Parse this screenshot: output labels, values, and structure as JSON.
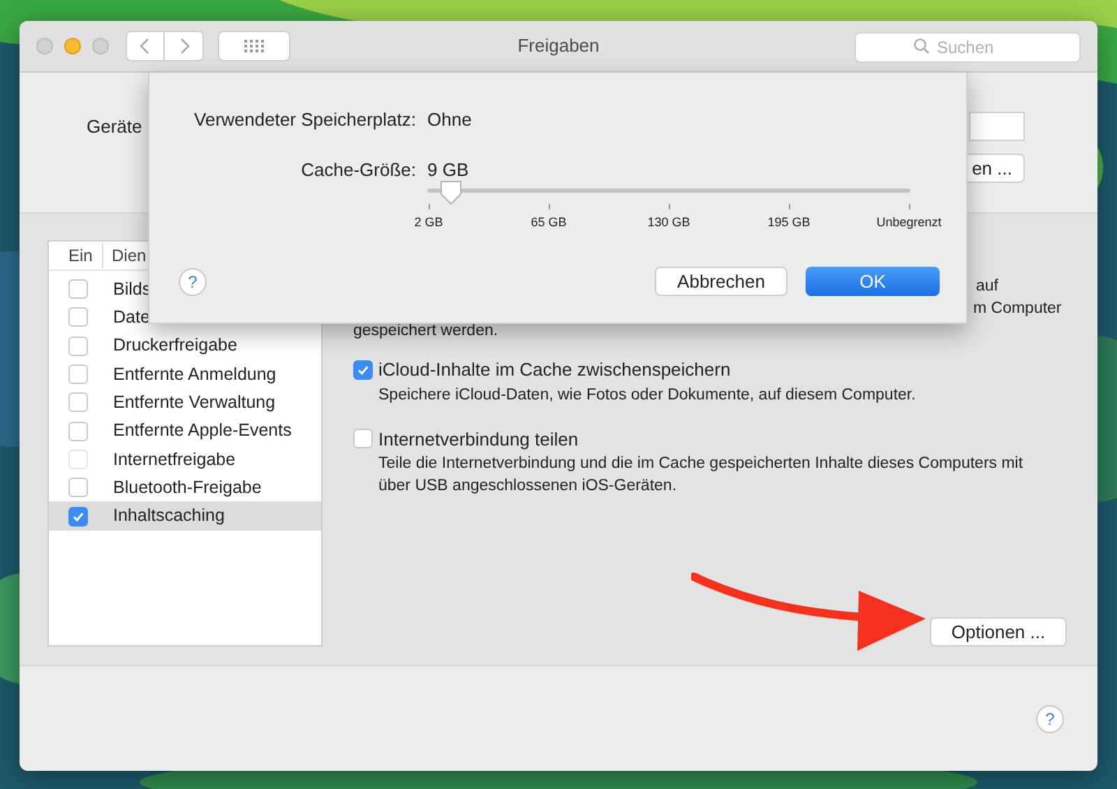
{
  "window": {
    "title": "Freigaben"
  },
  "toolbar": {
    "search": {
      "placeholder": "Suchen"
    }
  },
  "header": {
    "name_label": "Geräte",
    "edit_button": "en ..."
  },
  "services": {
    "columns": [
      "Ein",
      "Dien"
    ],
    "items": [
      {
        "label": "Bilds",
        "checked": false,
        "selected": false,
        "disabled": false
      },
      {
        "label": "Date",
        "checked": false,
        "selected": false,
        "disabled": false
      },
      {
        "label": "Druckerfreigabe",
        "checked": false,
        "selected": false,
        "disabled": false
      },
      {
        "label": "Entfernte Anmeldung",
        "checked": false,
        "selected": false,
        "disabled": false
      },
      {
        "label": "Entfernte Verwaltung",
        "checked": false,
        "selected": false,
        "disabled": false
      },
      {
        "label": "Entfernte Apple-Events",
        "checked": false,
        "selected": false,
        "disabled": false
      },
      {
        "label": "Internetfreigabe",
        "checked": false,
        "selected": false,
        "disabled": true
      },
      {
        "label": "Bluetooth-Freigabe",
        "checked": false,
        "selected": false,
        "disabled": false
      },
      {
        "label": "Inhaltscaching",
        "checked": true,
        "selected": true,
        "disabled": false
      }
    ]
  },
  "detail": {
    "partial_lines": [
      "auf",
      "m Computer"
    ],
    "partial_text": "gespeichert werden.",
    "options": [
      {
        "label": "iCloud-Inhalte im Cache zwischenspeichern",
        "checked": true,
        "description": [
          "Speichere iCloud-Daten, wie Fotos oder Dokumente, auf diesem Computer."
        ]
      },
      {
        "label": "Internetverbindung teilen",
        "checked": false,
        "description": [
          "Teile die Internetverbindung und die im Cache gespeicherten Inhalte dieses Computers mit",
          "über USB angeschlossenen iOS-Geräten."
        ]
      }
    ],
    "options_button": "Optionen ..."
  },
  "sheet": {
    "rows": [
      {
        "label": "Verwendeter Speicherplatz:",
        "value": "Ohne"
      },
      {
        "label": "Cache-Größe:",
        "value": "9 GB"
      }
    ],
    "slider": {
      "level": 0.05,
      "ticks": [
        "2 GB",
        "65 GB",
        "130 GB",
        "195 GB",
        "Unbegrenzt"
      ]
    },
    "cancel_button": "Abbrechen",
    "ok_button": "OK"
  },
  "help": "?",
  "sheet_help": "?"
}
